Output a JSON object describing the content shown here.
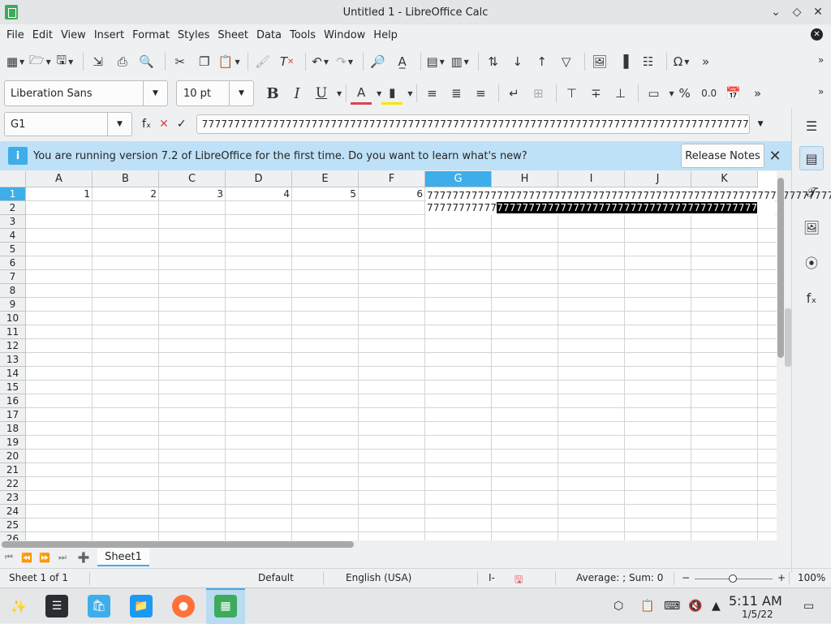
{
  "window": {
    "title": "Untitled 1 - LibreOffice Calc"
  },
  "menu": [
    "File",
    "Edit",
    "View",
    "Insert",
    "Format",
    "Styles",
    "Sheet",
    "Data",
    "Tools",
    "Window",
    "Help"
  ],
  "format_toolbar": {
    "font_name": "Liberation Sans",
    "font_size": "10 pt",
    "bold": "B",
    "italic": "I",
    "underline": "U"
  },
  "formula_bar": {
    "cell_ref": "G1",
    "fx_label": "fₓ",
    "content": "7777777777777777777777777777777777777777777777777777777777777777777777777777777777777777"
  },
  "infobar": {
    "message": "You are running version 7.2 of LibreOffice for the first time. Do you want to learn what's new?",
    "button": "Release Notes"
  },
  "grid": {
    "columns": [
      "A",
      "B",
      "C",
      "D",
      "E",
      "F",
      "G",
      "H",
      "I",
      "J",
      "K"
    ],
    "selected_column": "G",
    "rows": [
      "1",
      "2",
      "3",
      "4",
      "5",
      "6",
      "7",
      "8",
      "9",
      "10",
      "11",
      "12",
      "13",
      "14",
      "15",
      "16",
      "17",
      "18",
      "19",
      "20",
      "21",
      "22",
      "23",
      "24",
      "25",
      "26"
    ],
    "selected_row": "1",
    "row1_values": [
      "1",
      "2",
      "3",
      "4",
      "5",
      "6"
    ],
    "g1_line1": "7777777777777777777777777777777777777777777777777777777777777777777",
    "g1_line2_plain": "77777777777",
    "g1_line2_selected": "77777777777777777777777777777777777777777"
  },
  "sheet_tabs": {
    "active": "Sheet1"
  },
  "status_bar": {
    "sheet_info": "Sheet 1 of 1",
    "page_style": "Default",
    "language": "English (USA)",
    "summary": "Average: ; Sum: 0",
    "zoom_minus": "−",
    "zoom_plus": "+",
    "zoom": "100%"
  },
  "taskbar": {
    "time": "5:11 AM",
    "date": "1/5/22",
    "apps": [
      "app-launcher",
      "system-settings",
      "discover",
      "file-manager",
      "firefox",
      "libreoffice-calc"
    ]
  },
  "colors": {
    "accent": "#3daee9",
    "infobar": "#bfe1f7",
    "selected_text_bg": "#000000"
  }
}
